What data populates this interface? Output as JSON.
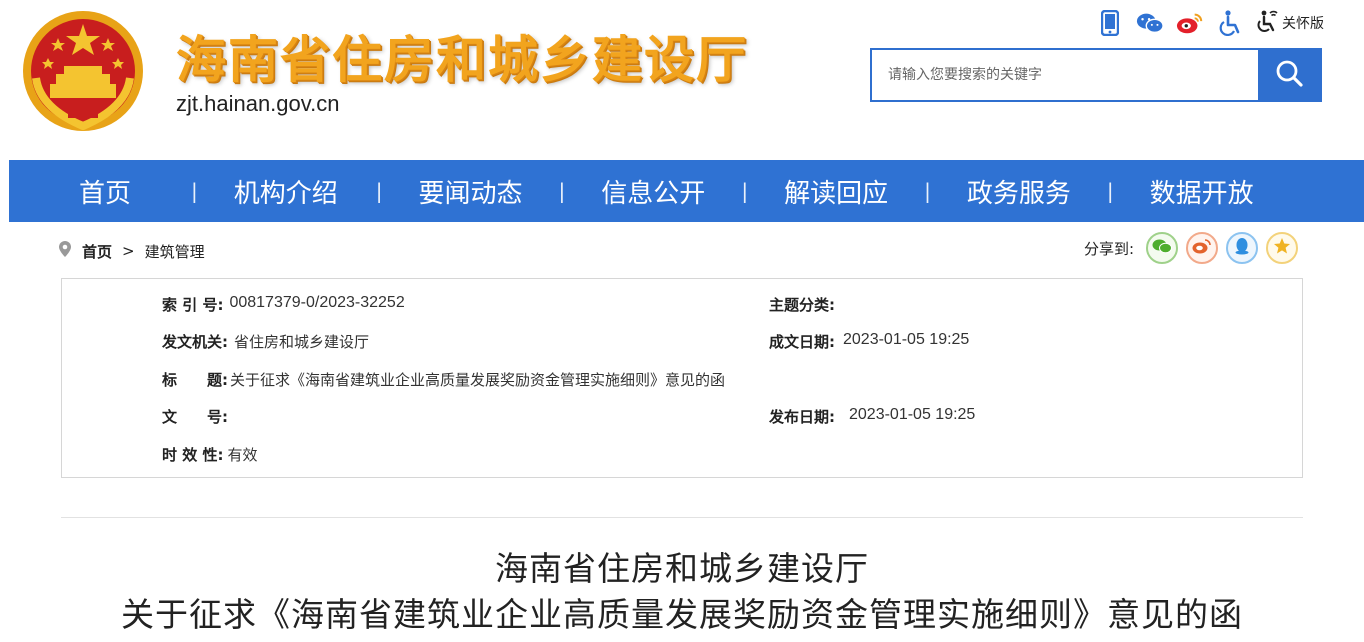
{
  "header": {
    "site_title": "海南省住房和城乡建设厅",
    "site_domain": "zjt.hainan.gov.cn",
    "care_mode_label": "关怀版",
    "icons": [
      "mobile-icon",
      "wechat-icon",
      "weibo-icon",
      "accessibility-icon",
      "care-mode-icon"
    ]
  },
  "search": {
    "placeholder": "请输入您要搜索的关键字",
    "value": ""
  },
  "nav": {
    "items": [
      {
        "label": "首页"
      },
      {
        "label": "机构介绍"
      },
      {
        "label": "要闻动态"
      },
      {
        "label": "信息公开"
      },
      {
        "label": "解读回应"
      },
      {
        "label": "政务服务"
      },
      {
        "label": "数据开放"
      }
    ]
  },
  "breadcrumb": {
    "home": "首页",
    "separator": ">",
    "current": "建筑管理"
  },
  "share": {
    "label": "分享到:",
    "targets": [
      "wechat",
      "weibo",
      "qq",
      "qzone"
    ]
  },
  "meta": {
    "index_label": "索 引 号:",
    "index_value": "00817379-0/2023-32252",
    "topic_label": "主题分类:",
    "topic_value": "",
    "issuer_label": "发文机关:",
    "issuer_value": "省住房和城乡建设厅",
    "created_label": "成文日期:",
    "created_value": "2023-01-05 19:25",
    "title_label": "标　　题:",
    "title_value": "关于征求《海南省建筑业企业高质量发展奖励资金管理实施细则》意见的函",
    "docno_label": "文　　号:",
    "docno_value": "",
    "published_label": "发布日期:",
    "published_value": "2023-01-05 19:25",
    "validity_label": "时 效 性:",
    "validity_value": "有效"
  },
  "document": {
    "title_line1": "海南省住房和城乡建设厅",
    "title_line2": "关于征求《海南省建筑业企业高质量发展奖励资金管理实施细则》意见的函"
  },
  "colors": {
    "nav_blue": "#2f72d3",
    "title_orange": "#f2a41e",
    "share_wechat": "#4fae2e",
    "share_weibo": "#e3632d",
    "share_qq": "#2f8fe0",
    "share_qzone": "#f0b323"
  }
}
